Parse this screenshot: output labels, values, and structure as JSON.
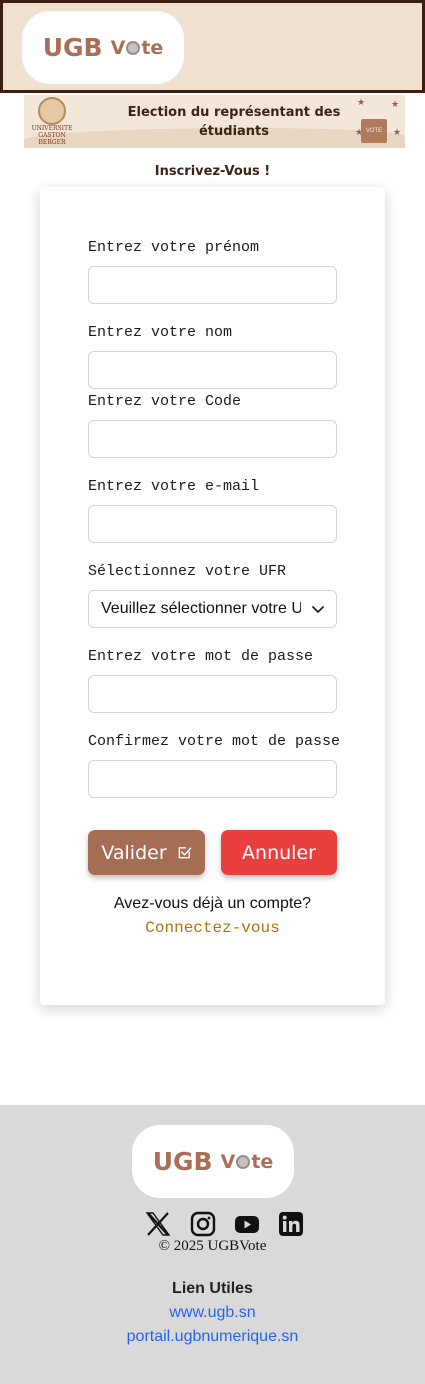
{
  "header": {
    "logo": {
      "left": "UGB",
      "right": "Vte"
    }
  },
  "banner": {
    "seal_text_1": "UNIVERSITE",
    "seal_text_2": "GASTON BERGER",
    "title": "Election du représentant des étudiants",
    "ballot_label": "VOTE"
  },
  "page": {
    "heading": "Inscrivez-Vous !"
  },
  "form": {
    "prenom_label": "Entrez votre prénom",
    "prenom_value": "",
    "nom_label": "Entrez votre nom",
    "nom_value": "",
    "code_label": "Entrez votre Code",
    "code_value": "",
    "email_label": "Entrez votre e-mail",
    "email_value": "",
    "ufr_label": "Sélectionnez votre UFR",
    "ufr_selected": "Veuillez sélectionner votre UFR",
    "password_label": "Entrez votre mot de passe",
    "password_value": "",
    "confirm_label": "Confirmez votre mot de passe",
    "confirm_value": "",
    "submit_label": "Valider",
    "cancel_label": "Annuler",
    "has_account": "Avez-vous déjà un compte?",
    "login_link": "Connectez-vous"
  },
  "footer": {
    "logo": {
      "left": "UGB",
      "right": "Vte"
    },
    "socials": [
      "x-icon",
      "instagram-icon",
      "youtube-icon",
      "linkedin-icon"
    ],
    "copyright": "© 2025 UGBVote",
    "links_title": "Lien Utiles",
    "links": [
      "www.ugb.sn",
      "portail.ugbnumerique.sn"
    ]
  },
  "colors": {
    "header_bg": "#f0e0d0",
    "brand_brown": "#a86f56",
    "valider_bg": "#a66d55",
    "annuler_bg": "#e93f3d",
    "link_gold": "#b07210",
    "footer_link": "#2563eb",
    "footer_bg": "#d9d9d9"
  }
}
